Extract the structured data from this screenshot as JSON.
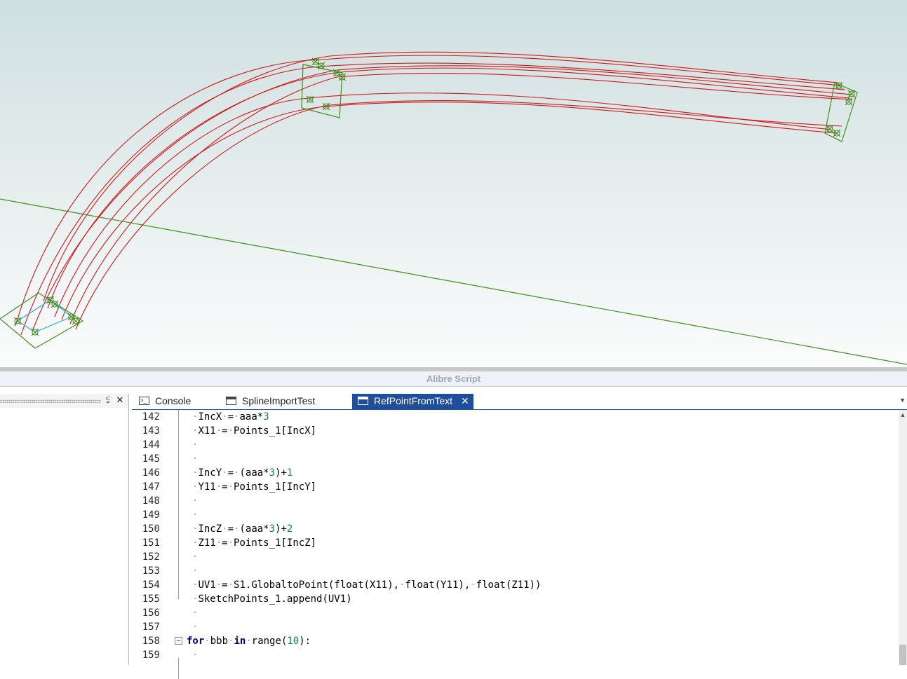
{
  "panel": {
    "title": "Alibre Script"
  },
  "left_pane": {
    "pin_glyph": "⫋",
    "close_glyph": "✕"
  },
  "tabs": [
    {
      "label": "Console",
      "icon": "console-icon"
    },
    {
      "label": "SplineImportTest",
      "icon": "script-window-icon"
    },
    {
      "label": "RefPointFromText",
      "icon": "script-window-icon",
      "active": true
    }
  ],
  "tab_close_glyph": "✕",
  "code": {
    "lines": [
      {
        "n": "142",
        "text": "IncX = aaa*3"
      },
      {
        "n": "143",
        "text": "X11 = Points_1[IncX]"
      },
      {
        "n": "144",
        "text": ""
      },
      {
        "n": "145",
        "text": ""
      },
      {
        "n": "146",
        "text": "IncY = (aaa*3)+1"
      },
      {
        "n": "147",
        "text": "Y11 = Points_1[IncY]"
      },
      {
        "n": "148",
        "text": ""
      },
      {
        "n": "149",
        "text": ""
      },
      {
        "n": "150",
        "text": "IncZ = (aaa*3)+2"
      },
      {
        "n": "151",
        "text": "Z11 = Points_1[IncZ]"
      },
      {
        "n": "152",
        "text": ""
      },
      {
        "n": "153",
        "text": ""
      },
      {
        "n": "154",
        "text": "UV1 = S1.GlobaltoPoint(float(X11), float(Y11), float(Z11))"
      },
      {
        "n": "155",
        "text": "SketchPoints_1.append(UV1)"
      },
      {
        "n": "156",
        "text": ""
      },
      {
        "n": "157",
        "text": ""
      },
      {
        "n": "158",
        "text": "for bbb in range(10):"
      },
      {
        "n": "159",
        "text": ""
      }
    ]
  },
  "colors": {
    "spline": "#d01818",
    "sketch": "#3f8f1f",
    "sketch_cyan": "#2aa8c8",
    "axis": "#3f8f1f",
    "active_tab": "#1f4e9c"
  }
}
